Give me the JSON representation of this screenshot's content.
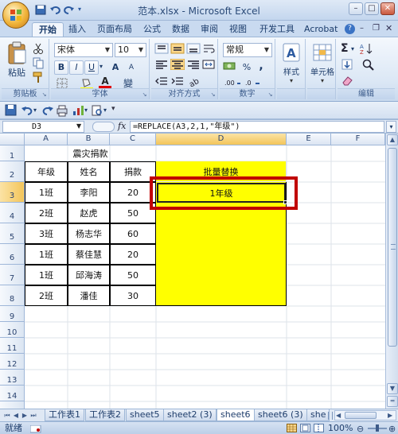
{
  "window": {
    "title": "范本.xlsx - Microsoft Excel"
  },
  "tabs": [
    "开始",
    "插入",
    "页面布局",
    "公式",
    "数据",
    "审阅",
    "视图",
    "开发工具",
    "Acrobat"
  ],
  "ribbon": {
    "clipboard": {
      "label": "剪贴板",
      "paste": "粘贴"
    },
    "font": {
      "label": "字体",
      "font_name": "宋体",
      "font_size": "10",
      "bold": "B",
      "italic": "I",
      "underline": "U",
      "grow": "A",
      "shrink": "A",
      "phonetic": "變"
    },
    "alignment": {
      "label": "对齐方式"
    },
    "number": {
      "label": "数字",
      "format": "常规",
      "percent": "%",
      "comma": ","
    },
    "styles": {
      "label": "样式"
    },
    "cells": {
      "label": "单元格"
    },
    "editing": {
      "label": "编辑"
    }
  },
  "formula_bar": {
    "name_box": "D3",
    "fx": "fx",
    "formula": "=REPLACE(A3,2,1,\"年级\")"
  },
  "columns": [
    "A",
    "B",
    "C",
    "D",
    "E",
    "F"
  ],
  "rows": [
    "1",
    "2",
    "3",
    "4",
    "5",
    "6",
    "7",
    "8",
    "9",
    "10",
    "11",
    "12",
    "13",
    "14"
  ],
  "sheet": {
    "title": "震灾捐款",
    "headers": [
      "年级",
      "姓名",
      "捐款"
    ],
    "d_header": "批量替换",
    "data": [
      [
        "1班",
        "李阳",
        "20"
      ],
      [
        "2班",
        "赵虎",
        "50"
      ],
      [
        "3班",
        "杨志华",
        "60"
      ],
      [
        "1班",
        "蔡佳慧",
        "20"
      ],
      [
        "1班",
        "邱海涛",
        "50"
      ],
      [
        "2班",
        "潘佳",
        "30"
      ]
    ],
    "d3_value": "1年级"
  },
  "sheet_tabs": [
    "工作表1",
    "工作表2",
    "sheet5",
    "sheet2 (3)",
    "sheet6",
    "sheet6 (3)",
    "she"
  ],
  "status": {
    "ready": "就绪",
    "zoom": "100%"
  },
  "colors": {
    "highlight": "#ffff00",
    "annotation": "#c00000"
  }
}
